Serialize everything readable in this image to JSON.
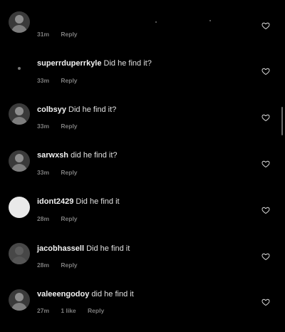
{
  "top_partial": {
    "time": "31m",
    "reply": "Reply"
  },
  "comments": [
    {
      "username": "superrduperrkyle",
      "text": "Did he find it?",
      "time": "33m",
      "likes": "",
      "reply": "Reply",
      "avatar": "dot"
    },
    {
      "username": "colbsyy",
      "text": "Did he find it?",
      "time": "33m",
      "likes": "",
      "reply": "Reply",
      "avatar": "photo"
    },
    {
      "username": "sarwxsh",
      "text": "did he find it?",
      "time": "33m",
      "likes": "",
      "reply": "Reply",
      "avatar": "photo"
    },
    {
      "username": "idont2429",
      "text": "Did he find it",
      "time": "28m",
      "likes": "",
      "reply": "Reply",
      "avatar": "white"
    },
    {
      "username": "jacobhassell",
      "text": "Did he find it",
      "time": "28m",
      "likes": "",
      "reply": "Reply",
      "avatar": "dark"
    },
    {
      "username": "valeeengodoy",
      "text": "did he find it",
      "time": "27m",
      "likes": "1 like",
      "reply": "Reply",
      "avatar": "photo"
    }
  ],
  "icons": {
    "like": "heart-outline-icon"
  },
  "colors": {
    "background": "#000000",
    "text": "#ececec",
    "muted": "#7d7d7d"
  }
}
